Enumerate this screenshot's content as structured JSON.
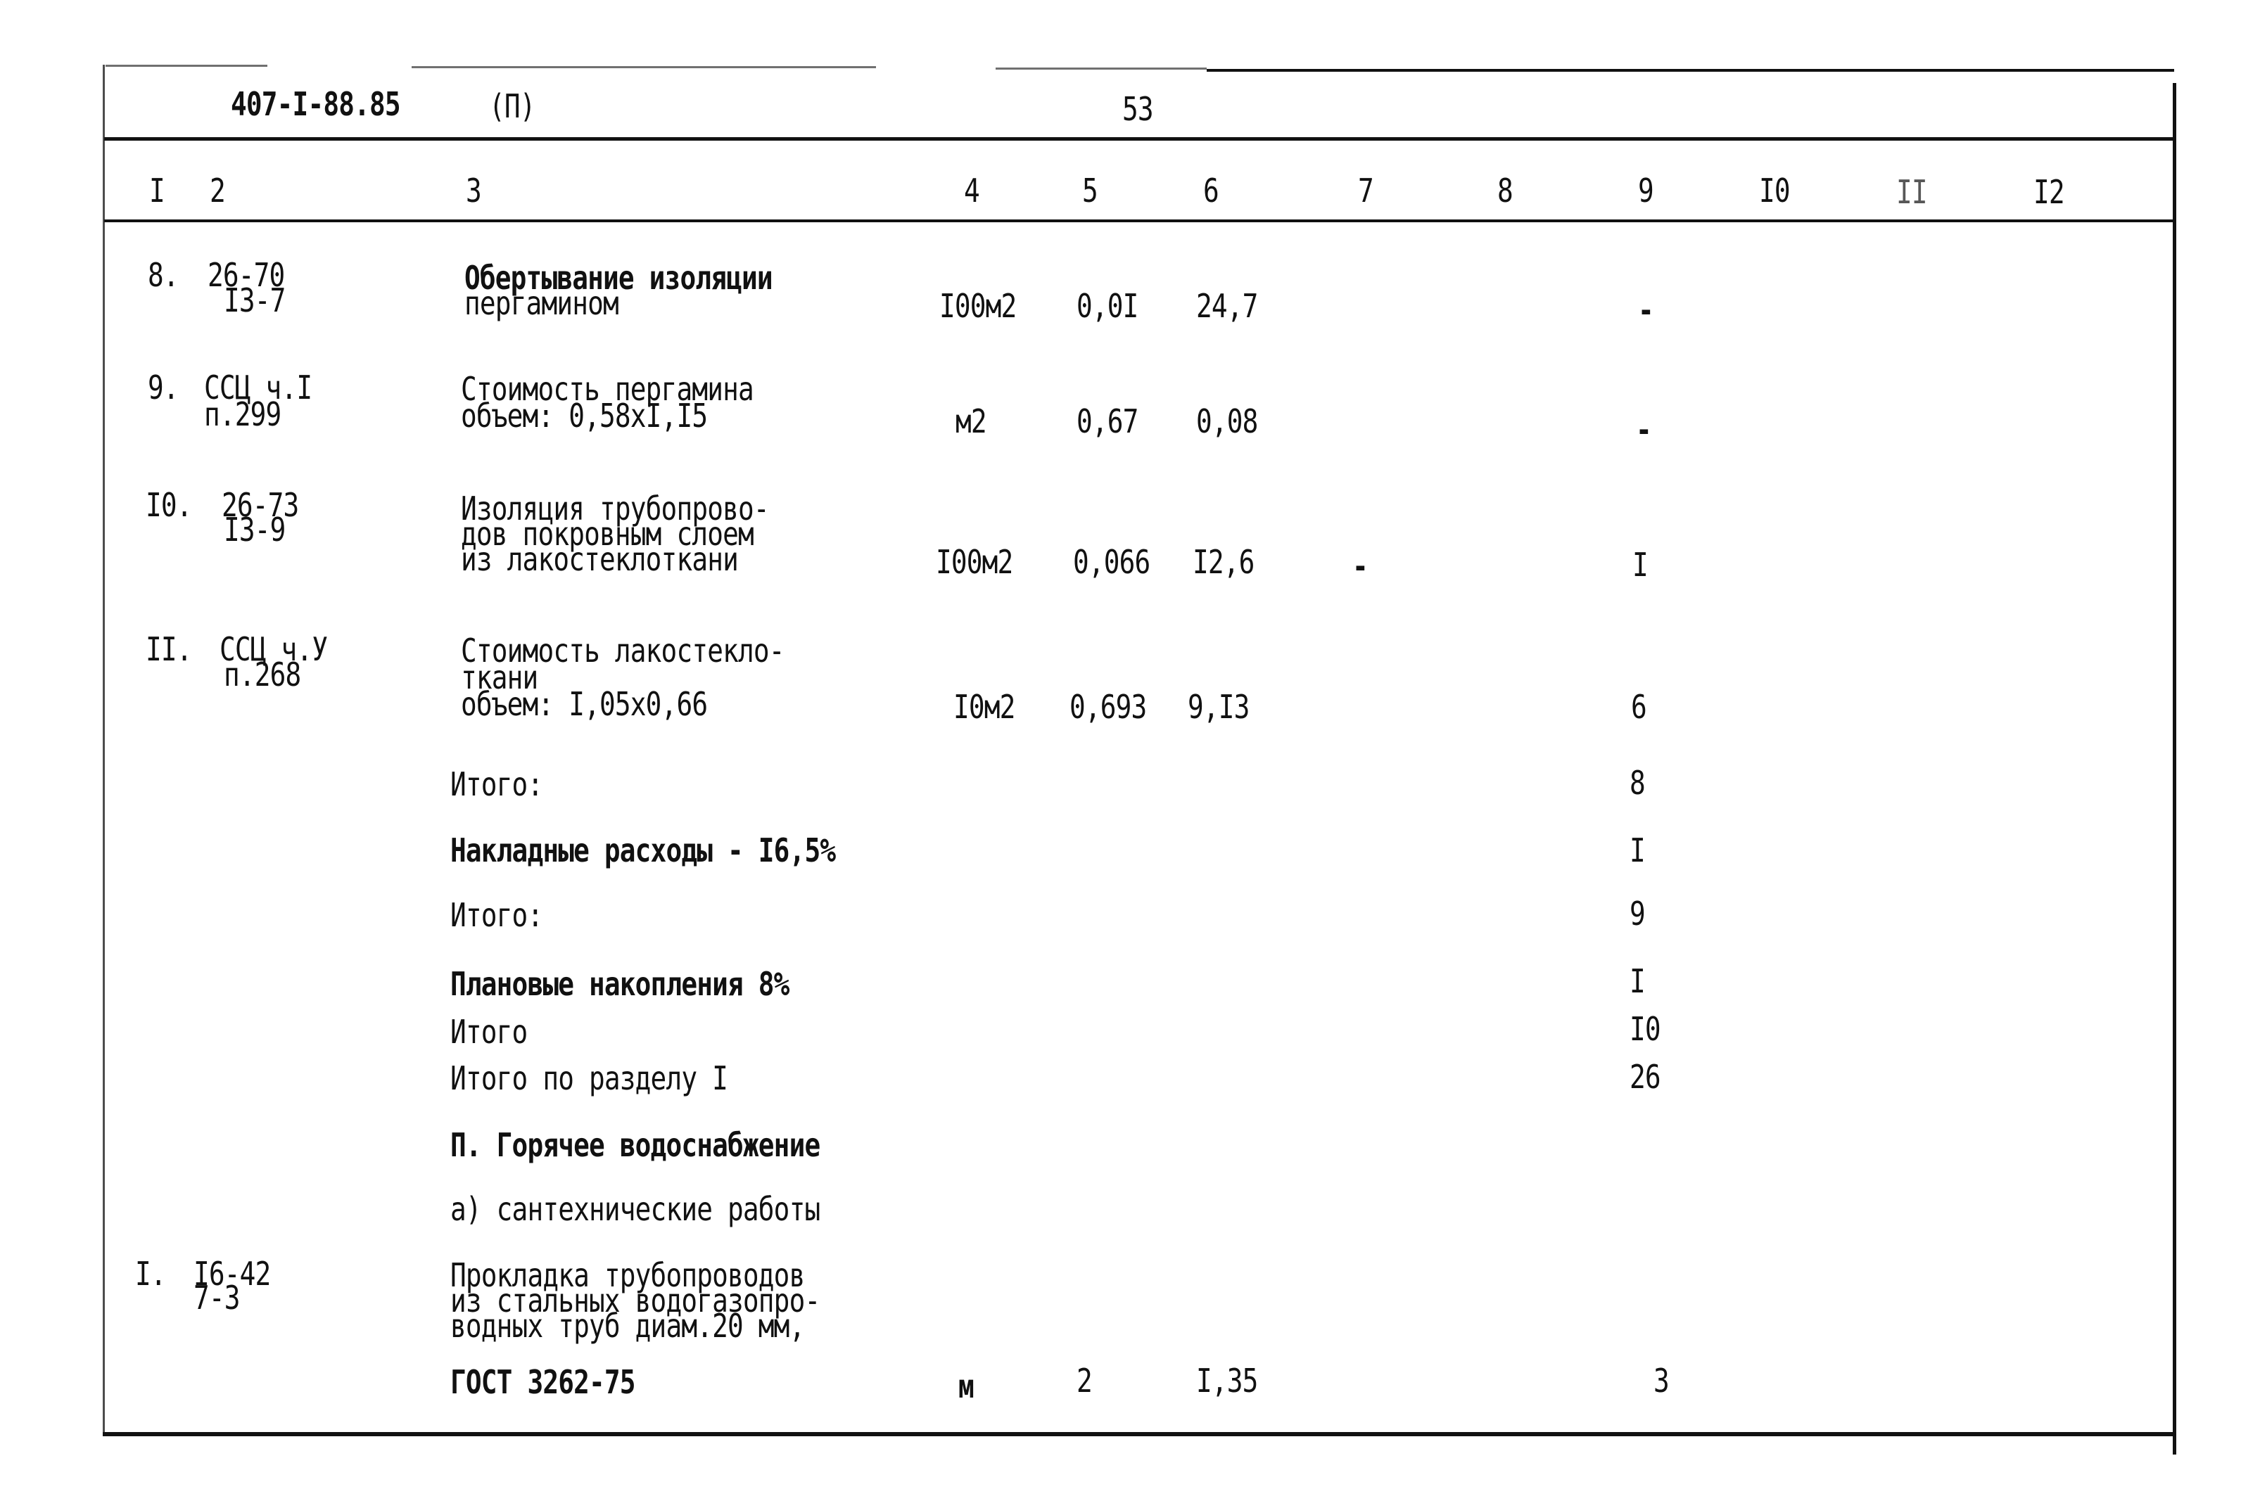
{
  "header": {
    "doc_code": "407-I-88.85",
    "part": "(П)",
    "page_number": "53"
  },
  "column_headers": [
    "I",
    "2",
    "3",
    "4",
    "5",
    "6",
    "7",
    "8",
    "9",
    "I0",
    "II",
    "I2"
  ],
  "rows": [
    {
      "num": "8.",
      "code": [
        "26-70",
        "I3-7"
      ],
      "description": [
        "Обертывание изоляции",
        "пергамином"
      ],
      "unit": "I00м2",
      "quantity": "0,0I",
      "price": "24,7",
      "col7": "",
      "col9": "-"
    },
    {
      "num": "9.",
      "code": [
        "ССЦ ч.I",
        "п.299"
      ],
      "description": [
        "Стоимость пергамина",
        "объем: 0,58xI,I5"
      ],
      "unit": "м2",
      "quantity": "0,67",
      "price": "0,08",
      "col7": "",
      "col9": "-"
    },
    {
      "num": "I0.",
      "code": [
        "26-73",
        "I3-9"
      ],
      "description": [
        "Изоляция трубопрово-",
        "дов покровным слоем",
        "из лакостеклоткани"
      ],
      "unit": "I00м2",
      "quantity": "0,066",
      "price": "I2,6",
      "col7": "-",
      "col9": "I"
    },
    {
      "num": "II.",
      "code": [
        "ССЦ ч.У",
        "п.268"
      ],
      "description": [
        "Стоимость лакостекло-",
        "ткани",
        "объем: I,05x0,66"
      ],
      "unit": "I0м2",
      "quantity": "0,693",
      "price": "9,I3",
      "col7": "",
      "col9": "6"
    }
  ],
  "summary": [
    {
      "label": "Итого:",
      "col9": "8"
    },
    {
      "label": "Накладные расходы - I6,5%",
      "col9": "I"
    },
    {
      "label": "Итого:",
      "col9": "9"
    },
    {
      "label": "Плановые накопления 8%",
      "col9": "I"
    },
    {
      "label": "Итого",
      "col9": "I0"
    },
    {
      "label": "Итого по разделу I",
      "col9": "26"
    }
  ],
  "section": {
    "title": "П. Горячее водоснабжение",
    "subtitle": "а) сантехнические работы"
  },
  "section_rows": [
    {
      "num": "I.",
      "code": [
        "I6-42",
        "7-3"
      ],
      "description": [
        "Прокладка трубопроводов",
        "из стальных водогазопро-",
        "водных труб диам.20 мм,"
      ],
      "standard": "ГОСТ 3262-75",
      "unit": "м",
      "quantity": "2",
      "price": "I,35",
      "col9": "3"
    }
  ]
}
